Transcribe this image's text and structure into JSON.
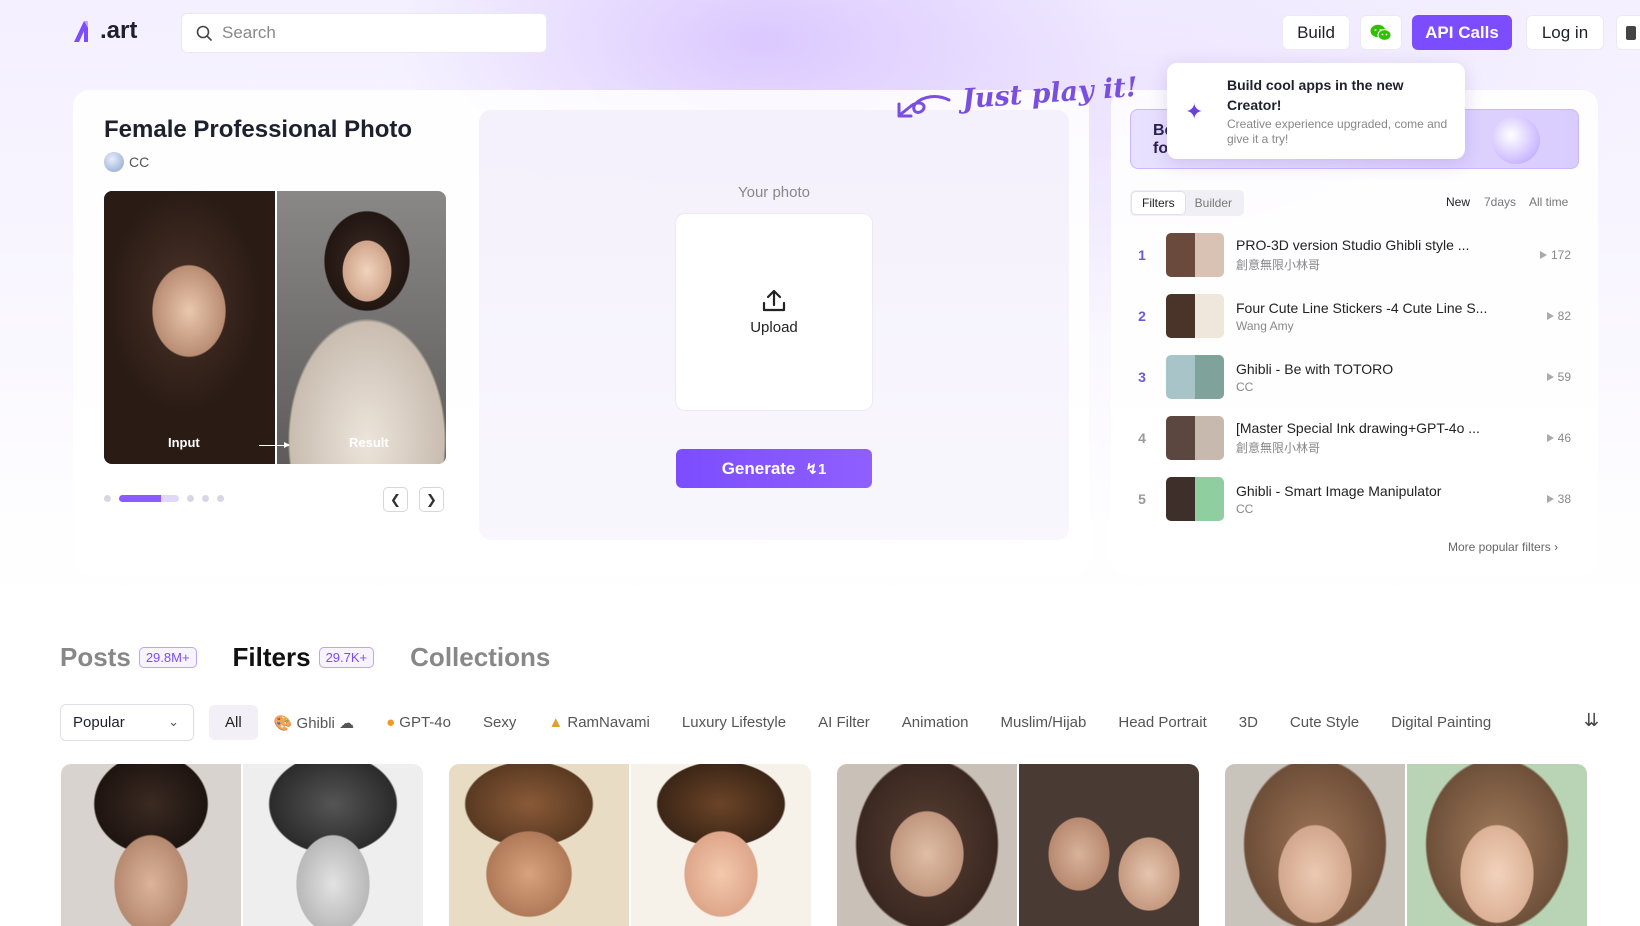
{
  "header": {
    "logo_text": ".art",
    "search_placeholder": "Search",
    "build_label": "Build",
    "api_label": "API Calls",
    "login_label": "Log in"
  },
  "feature": {
    "title": "Female Professional Photo",
    "author": "CC",
    "input_label": "Input",
    "result_label": "Result",
    "slide_active": 1,
    "slide_total": 5
  },
  "upload": {
    "your_photo": "Your photo",
    "upload_label": "Upload",
    "generate_label": "Generate",
    "generate_cost": "1",
    "tagline": "Just play it!"
  },
  "creator_tip": {
    "banner_text": "Be fo",
    "title": "Build cool apps in the new Creator!",
    "subtitle": "Creative experience upgraded, come and give it a try!"
  },
  "ranking": {
    "tabs": [
      "Filters",
      "Builder"
    ],
    "ranges": [
      "New",
      "7days",
      "All time"
    ],
    "items": [
      {
        "rank": "1",
        "title": "PRO-3D version Studio Ghibli style ...",
        "author": "創意無限小林哥",
        "count": "172"
      },
      {
        "rank": "2",
        "title": "Four Cute Line Stickers -4 Cute Line S...",
        "author": "Wang Amy",
        "count": "82"
      },
      {
        "rank": "3",
        "title": "Ghibli - Be with TOTORO",
        "author": "CC",
        "count": "59"
      },
      {
        "rank": "4",
        "title": "[Master Special Ink drawing+GPT-4o ...",
        "author": "創意無限小林哥",
        "count": "46"
      },
      {
        "rank": "5",
        "title": "Ghibli - Smart Image Manipulator",
        "author": "CC",
        "count": "38"
      }
    ],
    "more_label": "More popular filters"
  },
  "content_tabs": [
    {
      "label": "Posts",
      "badge": "29.8M+"
    },
    {
      "label": "Filters",
      "badge": "29.7K+"
    },
    {
      "label": "Collections",
      "badge": ""
    }
  ],
  "sort": {
    "selected": "Popular"
  },
  "categories": [
    "All",
    "Ghibli",
    "GPT-4o",
    "Sexy",
    "RamNavami",
    "Luxury Lifestyle",
    "AI Filter",
    "Animation",
    "Muslim/Hijab",
    "Head Portrait",
    "3D",
    "Cute Style",
    "Digital Painting"
  ],
  "colors": {
    "accent": "#7c4dff"
  }
}
